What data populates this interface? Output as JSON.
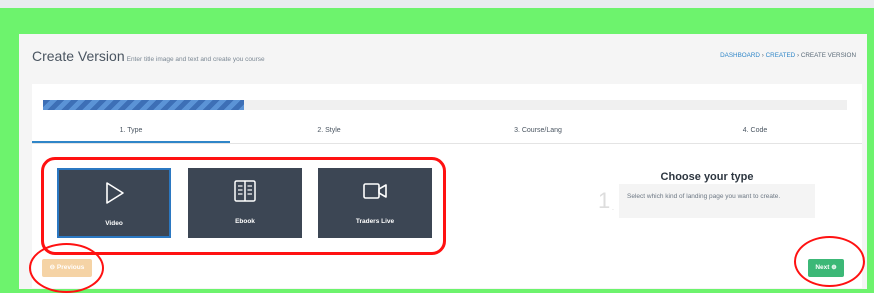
{
  "header": {
    "title": "Create Version",
    "subtitle": "Enter title image and text and create you course",
    "breadcrumb": {
      "dashboard": "DASHBOARD",
      "sep1": "›",
      "created": "CREATED",
      "sep2": "›",
      "current": "CREATE VERSION"
    }
  },
  "progress": {
    "percent": 25
  },
  "tabs": [
    {
      "label": "1. Type",
      "active": true
    },
    {
      "label": "2. Style",
      "active": false
    },
    {
      "label": "3. Course/Lang",
      "active": false
    },
    {
      "label": "4. Code",
      "active": false
    }
  ],
  "type_options": [
    {
      "label": "Video",
      "icon": "play-icon",
      "selected": true
    },
    {
      "label": "Ebook",
      "icon": "book-icon",
      "selected": false
    },
    {
      "label": "Traders Live",
      "icon": "camera-icon",
      "selected": false
    }
  ],
  "info": {
    "heading": "Choose your type",
    "step_number": "1",
    "step_dot": ".",
    "hint": "Select which kind of landing page you want to create."
  },
  "buttons": {
    "previous": "⊖ Previous",
    "next": "Next ⊕"
  },
  "colors": {
    "accent": "#2f86c8",
    "tile_bg": "#3c4654",
    "next_green": "#3cb877",
    "prev_orange": "#f5d3a5",
    "annotation_red": "#ff1111",
    "frame_green": "#6df36d"
  }
}
